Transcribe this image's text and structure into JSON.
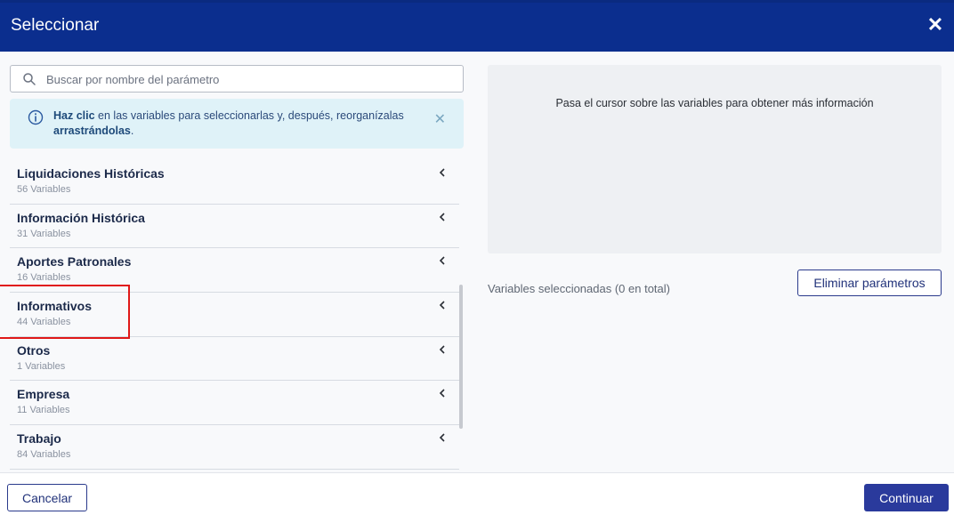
{
  "dialog": {
    "title": "Seleccionar",
    "close_symbol": "✕"
  },
  "search": {
    "placeholder": "Buscar por nombre del parámetro",
    "value": "",
    "icon": "search-icon"
  },
  "info_banner": {
    "bold_start": "Haz clic",
    "middle": " en las variables para seleccionarlas y, después, reorganízalas ",
    "bold_end": "arrastrándolas",
    "end": ".",
    "dismiss_symbol": "✕",
    "icon": "info-icon"
  },
  "categories": [
    {
      "name": "Liquidaciones Históricas",
      "count": "56 Variables"
    },
    {
      "name": "Información Histórica",
      "count": "31 Variables"
    },
    {
      "name": "Aportes Patronales",
      "count": "16 Variables"
    },
    {
      "name": "Informativos",
      "count": "44 Variables"
    },
    {
      "name": "Otros",
      "count": "1 Variables"
    },
    {
      "name": "Empresa",
      "count": "11 Variables"
    },
    {
      "name": "Trabajo",
      "count": "84 Variables"
    }
  ],
  "preview": {
    "message": "Pasa el cursor sobre las variables para obtener más información"
  },
  "selection": {
    "label": "Variables seleccionadas (0 en total)",
    "remove_button": "Eliminar parámetros"
  },
  "footer": {
    "cancel_button": "Cancelar",
    "continue_button": "Continuar"
  },
  "colors": {
    "header": "#0b2e8e",
    "accent": "#2a3a9c",
    "info_bg": "#dff2f8",
    "highlight": "#e01818"
  }
}
